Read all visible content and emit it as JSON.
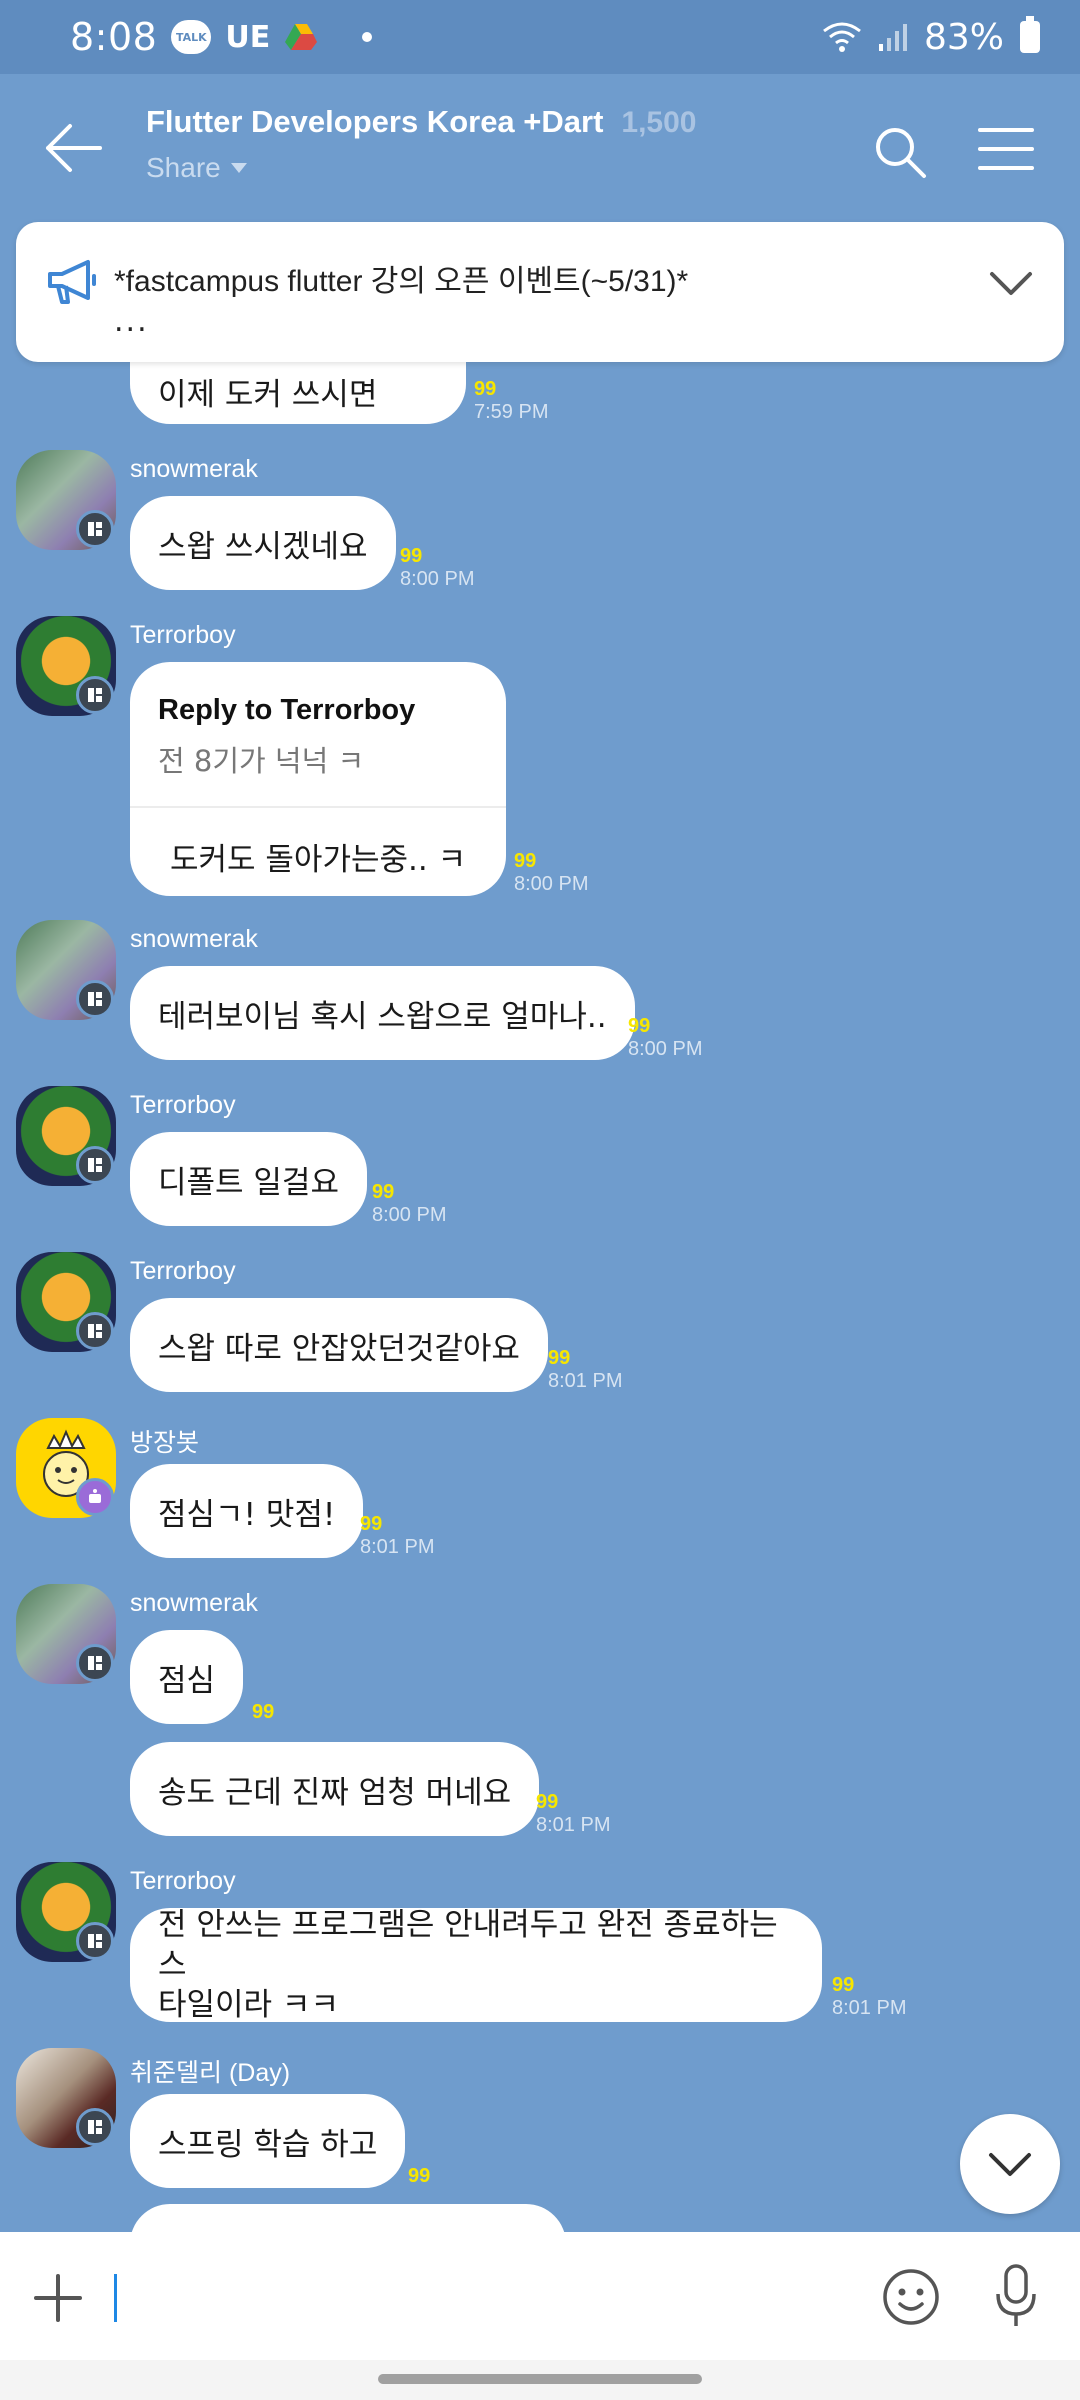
{
  "status_bar": {
    "time": "8:08",
    "talk_badge": "TALK",
    "network": "UE",
    "battery": "83%"
  },
  "header": {
    "title": "Flutter Developers Korea +Dart",
    "member_count": "1,500",
    "share_label": "Share"
  },
  "notice": {
    "text": "*fastcampus flutter 강의 오픈 이벤트(~5/31)*",
    "more": "..."
  },
  "messages": [
    {
      "text": "이제 도커 쓰시면",
      "unread": "99",
      "time": "7:59 PM"
    },
    {
      "sender": "snowmerak",
      "text": "스왑 쓰시겠네요",
      "unread": "99",
      "time": "8:00 PM"
    },
    {
      "sender": "Terrorboy",
      "reply_title": "Reply to Terrorboy",
      "reply_quote": "전 8기가 넉넉 ㅋ",
      "text": "도커도 돌아가는중.. ㅋ",
      "unread": "99",
      "time": "8:00 PM"
    },
    {
      "sender": "snowmerak",
      "text": "테러보이님 혹시 스왑으로 얼마나..",
      "unread": "99",
      "time": "8:00 PM"
    },
    {
      "sender": "Terrorboy",
      "text": "디폴트 일걸요",
      "unread": "99",
      "time": "8:00 PM"
    },
    {
      "sender": "Terrorboy",
      "text": "스왑 따로 안잡았던것같아요",
      "unread": "99",
      "time": "8:01 PM"
    },
    {
      "sender": "방장봇",
      "text": "점심ㄱ! 맛점!",
      "unread": "99",
      "time": "8:01 PM"
    },
    {
      "sender": "snowmerak",
      "text": "점심",
      "unread": "99"
    },
    {
      "text": "송도 근데 진짜 엄청 머네요",
      "unread": "99",
      "time": "8:01 PM"
    },
    {
      "sender": "Terrorboy",
      "text_line1": "전 안쓰는 프로그램은 안내려두고 완전 종료하는 스",
      "text_line2": "타일이라 ㅋㅋ",
      "unread": "99",
      "time": "8:01 PM"
    },
    {
      "sender": "취준델리 (Day)",
      "text": "스프링 학습 하고",
      "unread": "99"
    }
  ],
  "icons": {
    "back": "arrow-left-icon",
    "search": "search-icon",
    "menu": "hamburger-icon",
    "notice": "megaphone-icon",
    "scroll_down": "chevron-down-icon",
    "add": "plus-icon",
    "emoji": "emoji-icon",
    "mic": "mic-icon"
  },
  "colors": {
    "chat_background": "#6f9ccd",
    "unread_count": "#f7e600",
    "caret": "#1e88e5"
  }
}
